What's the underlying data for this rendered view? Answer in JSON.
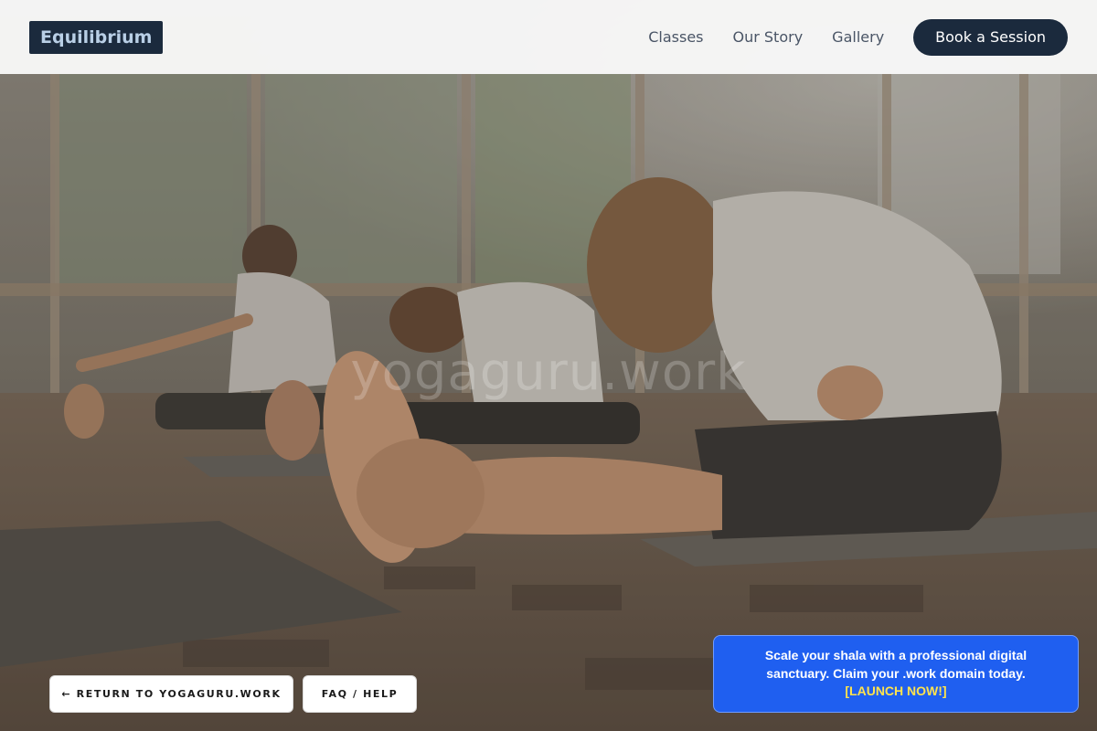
{
  "brand": {
    "name": "Equilibrium"
  },
  "nav": {
    "links": [
      "Classes",
      "Our Story",
      "Gallery"
    ],
    "cta_label": "Book a Session"
  },
  "hero": {
    "watermark": "yogaguru.work",
    "image_icon": "yoga-class-photo"
  },
  "footer_buttons": {
    "return_label": "← RETURN TO YOGAGURU.WORK",
    "faq_label": "FAQ / HELP"
  },
  "promo": {
    "message": "Scale your shala with a professional digital sanctuary. Claim your .work domain today.",
    "link_label": "[LAUNCH NOW!]"
  },
  "colors": {
    "brand_dark": "#1b2a3d",
    "promo_blue": "#1f5ff0",
    "promo_link": "#ffe34d"
  }
}
